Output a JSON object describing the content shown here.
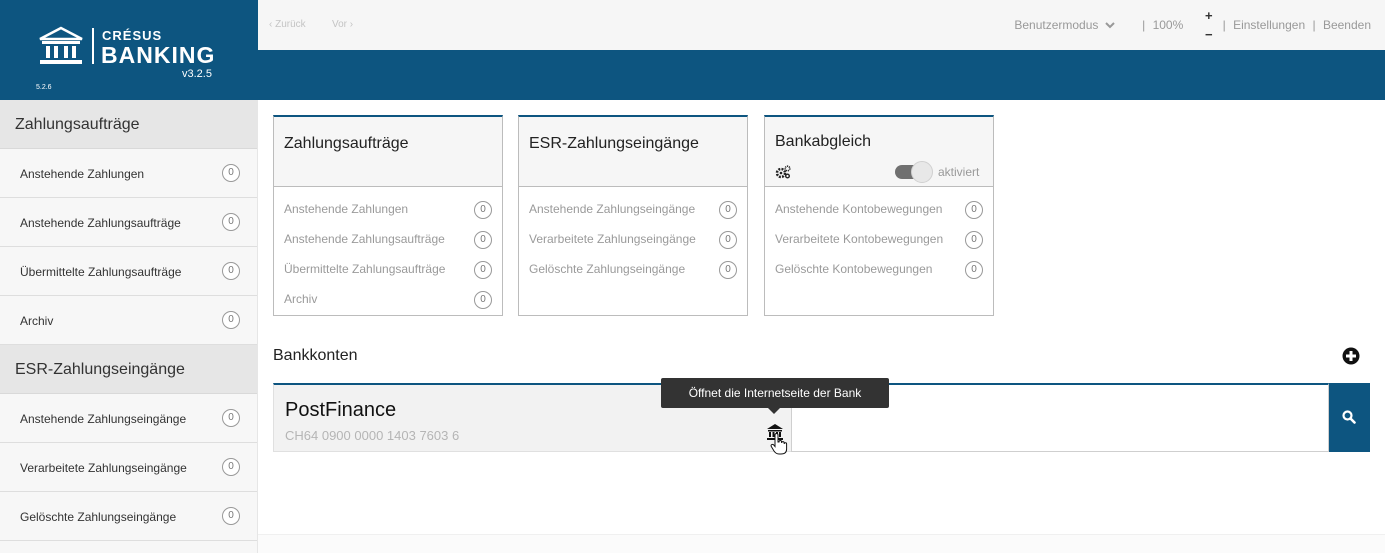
{
  "logo": {
    "brand_top": "CRÉSUS",
    "brand_bottom": "BANKING",
    "version": "v3.2.5",
    "small_version": "5.2.6"
  },
  "topbar": {
    "back": "‹ Zurück",
    "forward": "Vor ›",
    "mode": "Benutzermodus",
    "zoom": "100%",
    "plus": "+",
    "minus": "−",
    "settings": "Einstellungen",
    "quit": "Beenden",
    "separator": "|"
  },
  "sidebar": {
    "sections": [
      {
        "title": "Zahlungsaufträge",
        "items": [
          {
            "label": "Anstehende Zahlungen",
            "count": "0"
          },
          {
            "label": "Anstehende Zahlungsaufträge",
            "count": "0"
          },
          {
            "label": "Übermittelte Zahlungsaufträge",
            "count": "0"
          },
          {
            "label": "Archiv",
            "count": "0"
          }
        ]
      },
      {
        "title": "ESR-Zahlungseingänge",
        "items": [
          {
            "label": "Anstehende Zahlungseingänge",
            "count": "0"
          },
          {
            "label": "Verarbeitete Zahlungseingänge",
            "count": "0"
          },
          {
            "label": "Gelöschte Zahlungseingänge",
            "count": "0"
          }
        ]
      }
    ]
  },
  "cards": [
    {
      "title": "Zahlungsaufträge",
      "rows": [
        {
          "label": "Anstehende Zahlungen",
          "count": "0"
        },
        {
          "label": "Anstehende Zahlungsaufträge",
          "count": "0"
        },
        {
          "label": "Übermittelte Zahlungsaufträge",
          "count": "0"
        },
        {
          "label": "Archiv",
          "count": "0"
        }
      ]
    },
    {
      "title": "ESR-Zahlungseingänge",
      "rows": [
        {
          "label": "Anstehende Zahlungseingänge",
          "count": "0"
        },
        {
          "label": "Verarbeitete Zahlungseingänge",
          "count": "0"
        },
        {
          "label": "Gelöschte Zahlungseingänge",
          "count": "0"
        }
      ]
    },
    {
      "title": "Bankabgleich",
      "toggle_label": "aktiviert",
      "toggle_on": true,
      "rows": [
        {
          "label": "Anstehende Kontobewegungen",
          "count": "0"
        },
        {
          "label": "Verarbeitete Kontobewegungen",
          "count": "0"
        },
        {
          "label": "Gelöschte Kontobewegungen",
          "count": "0"
        }
      ]
    }
  ],
  "bank_accounts": {
    "title": "Bankkonten",
    "accounts": [
      {
        "name": "PostFinance",
        "iban": "CH64 0900 0000 1403 7603 6"
      }
    ],
    "tooltip": "Öffnet die Internetseite der Bank",
    "search_value": ""
  },
  "colors": {
    "brand": "#0d5580",
    "sidebar_header": "#e6e6e6",
    "tooltip": "#333333"
  },
  "icons": [
    "bank-icon",
    "chevron-down-icon",
    "gears-icon",
    "add-icon",
    "search-icon",
    "hand-cursor-icon"
  ]
}
